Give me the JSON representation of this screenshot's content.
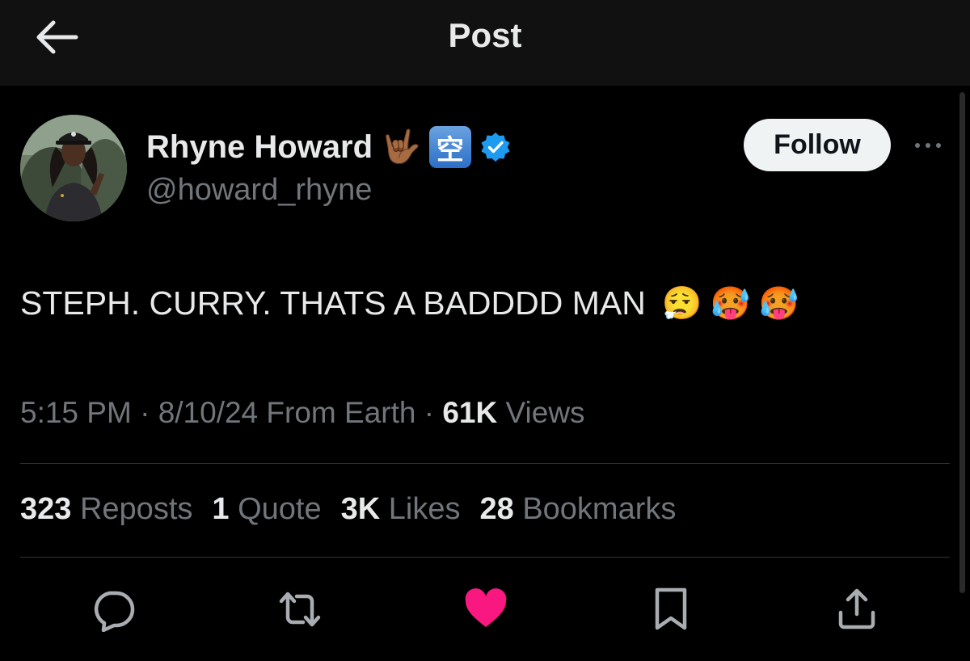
{
  "header": {
    "title": "Post",
    "back_icon": "arrow-left-icon"
  },
  "author": {
    "display_name": "Rhyne Howard",
    "name_emoji_1": "🤟🏾",
    "name_emoji_2": "空",
    "verified_icon": "verified-badge-icon",
    "handle": "@howard_rhyne",
    "follow_label": "Follow",
    "more_icon": "more-dots-icon"
  },
  "post": {
    "text": "STEPH. CURRY.  THATS A BADDDD MAN",
    "emojis": [
      "😮‍💨",
      "🥵",
      "🥵"
    ]
  },
  "meta": {
    "time": "5:15 PM",
    "sep1": " · ",
    "date": "8/10/24",
    "location": " From Earth",
    "sep2": " · ",
    "views_count": "61K",
    "views_label": " Views"
  },
  "stats": {
    "reposts_count": "323",
    "reposts_label": "Reposts",
    "quotes_count": "1",
    "quotes_label": "Quote",
    "likes_count": "3K",
    "likes_label": "Likes",
    "bookmarks_count": "28",
    "bookmarks_label": "Bookmarks"
  },
  "actions": {
    "reply_icon": "reply-bubble-icon",
    "repost_icon": "repost-icon",
    "like_icon": "heart-icon",
    "bookmark_icon": "bookmark-icon",
    "share_icon": "share-icon",
    "like_color": "#f91880"
  },
  "colors": {
    "background": "#000000",
    "header_bg": "#111111",
    "text_primary": "#e7e9ea",
    "text_secondary": "#71767b",
    "verified_blue": "#1d9bf0",
    "divider": "#2f3336"
  }
}
